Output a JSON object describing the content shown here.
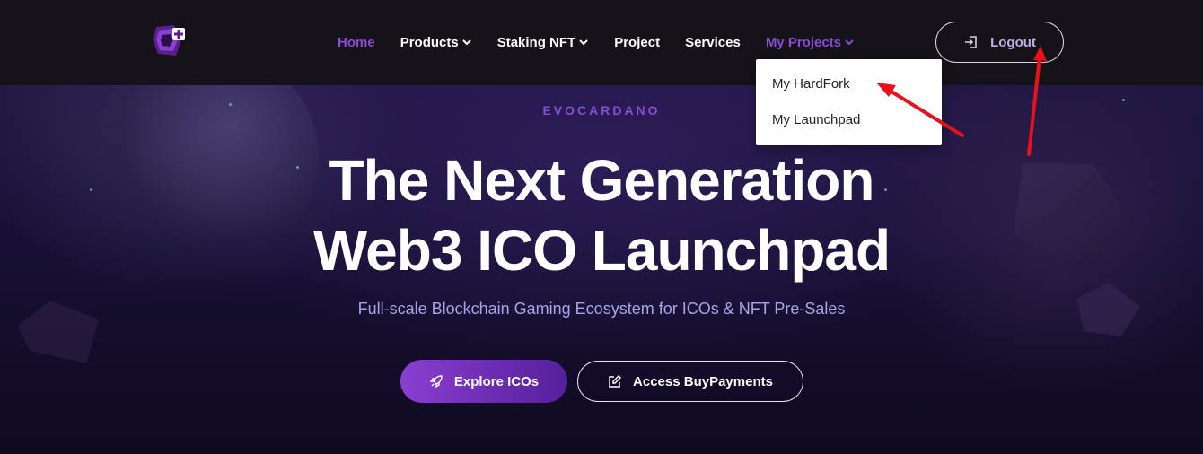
{
  "nav": {
    "items": [
      {
        "label": "Home",
        "state": "active"
      },
      {
        "label": "Products",
        "dropdown": true
      },
      {
        "label": "Staking NFT",
        "dropdown": true
      },
      {
        "label": "Project"
      },
      {
        "label": "Services"
      },
      {
        "label": "My Projects",
        "dropdown": true,
        "state": "open"
      }
    ],
    "logout_label": "Logout"
  },
  "dropdown": {
    "items": [
      "My HardFork",
      "My Launchpad"
    ]
  },
  "hero": {
    "eyebrow": "EVOCARDANO",
    "headline_line1": "The Next Generation",
    "headline_line2": "Web3 ICO Launchpad",
    "subtitle": "Full-scale Blockchain Gaming Ecosystem for ICOs & NFT Pre-Sales",
    "primary_button": "Explore ICOs",
    "secondary_button": "Access BuyPayments"
  },
  "icons": {
    "logo": "brand-logo-icon",
    "logout": "login-arrow-icon",
    "explore": "rocket-icon",
    "access": "edit-icon",
    "chevron": "chevron-down-icon"
  },
  "colors": {
    "accent": "#8a4bd6",
    "navbar_bg": "#151318",
    "hero_bg": "#1a1236",
    "annotation": "#e8101a"
  }
}
